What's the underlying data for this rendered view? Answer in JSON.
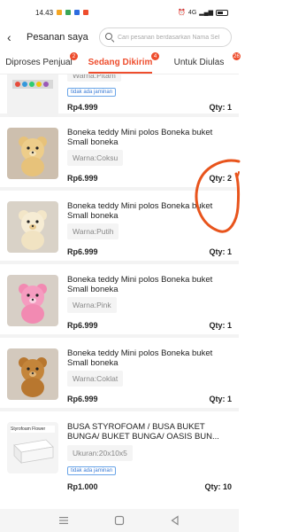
{
  "status_bar": {
    "time": "14.43",
    "network": "4G"
  },
  "header": {
    "back_icon": "back-arrow-icon",
    "title": "Pesanan saya",
    "search_placeholder": "Cari pesanan berdasarkan Nama Sel"
  },
  "tabs": [
    {
      "label": "Diproses Penjual",
      "badge": "2",
      "active": false
    },
    {
      "label": "Sedang Dikirim",
      "badge": "4",
      "active": true
    },
    {
      "label": "Untuk Diulas",
      "badge": "26",
      "active": false
    }
  ],
  "accent_color": "#ee4d2d",
  "items": [
    {
      "variant": "Warna:Pitam",
      "badge": "tidak ada jaminan",
      "price": "Rp4.999",
      "qty": "Qty: 1"
    },
    {
      "name": "Boneka teddy Mini polos Boneka buket Small boneka",
      "variant": "Warna:Coksu",
      "price": "Rp6.999",
      "qty": "Qty: 2"
    },
    {
      "name": "Boneka teddy Mini polos Boneka buket Small boneka",
      "variant": "Warna:Putih",
      "price": "Rp6.999",
      "qty": "Qty: 1"
    },
    {
      "name": "Boneka teddy Mini polos Boneka buket Small boneka",
      "variant": "Warna:Pink",
      "price": "Rp6.999",
      "qty": "Qty: 1"
    },
    {
      "name": "Boneka teddy Mini polos Boneka buket Small boneka",
      "variant": "Warna:Coklat",
      "price": "Rp6.999",
      "qty": "Qty: 1"
    },
    {
      "name": "BUSA STYROFOAM / BUSA BUKET BUNGA/ BUKET BUNGA/ OASIS BUN...",
      "variant": "Ukuran:20x10x5",
      "badge": "tidak ada jaminan",
      "price": "Rp1.000",
      "qty": "Qty: 10",
      "thumb_label": "Styrofoam Flower"
    }
  ],
  "annotation_color": "#e8541c",
  "navbar": {
    "icons": [
      "menu-icon",
      "home-icon",
      "back-icon"
    ]
  }
}
